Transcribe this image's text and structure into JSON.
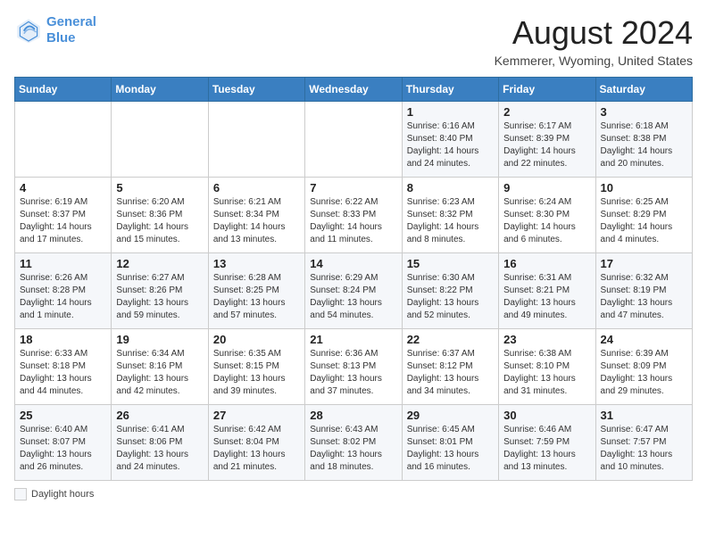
{
  "header": {
    "logo_line1": "General",
    "logo_line2": "Blue",
    "month": "August 2024",
    "location": "Kemmerer, Wyoming, United States"
  },
  "weekdays": [
    "Sunday",
    "Monday",
    "Tuesday",
    "Wednesday",
    "Thursday",
    "Friday",
    "Saturday"
  ],
  "weeks": [
    [
      {
        "day": "",
        "info": ""
      },
      {
        "day": "",
        "info": ""
      },
      {
        "day": "",
        "info": ""
      },
      {
        "day": "",
        "info": ""
      },
      {
        "day": "1",
        "info": "Sunrise: 6:16 AM\nSunset: 8:40 PM\nDaylight: 14 hours\nand 24 minutes."
      },
      {
        "day": "2",
        "info": "Sunrise: 6:17 AM\nSunset: 8:39 PM\nDaylight: 14 hours\nand 22 minutes."
      },
      {
        "day": "3",
        "info": "Sunrise: 6:18 AM\nSunset: 8:38 PM\nDaylight: 14 hours\nand 20 minutes."
      }
    ],
    [
      {
        "day": "4",
        "info": "Sunrise: 6:19 AM\nSunset: 8:37 PM\nDaylight: 14 hours\nand 17 minutes."
      },
      {
        "day": "5",
        "info": "Sunrise: 6:20 AM\nSunset: 8:36 PM\nDaylight: 14 hours\nand 15 minutes."
      },
      {
        "day": "6",
        "info": "Sunrise: 6:21 AM\nSunset: 8:34 PM\nDaylight: 14 hours\nand 13 minutes."
      },
      {
        "day": "7",
        "info": "Sunrise: 6:22 AM\nSunset: 8:33 PM\nDaylight: 14 hours\nand 11 minutes."
      },
      {
        "day": "8",
        "info": "Sunrise: 6:23 AM\nSunset: 8:32 PM\nDaylight: 14 hours\nand 8 minutes."
      },
      {
        "day": "9",
        "info": "Sunrise: 6:24 AM\nSunset: 8:30 PM\nDaylight: 14 hours\nand 6 minutes."
      },
      {
        "day": "10",
        "info": "Sunrise: 6:25 AM\nSunset: 8:29 PM\nDaylight: 14 hours\nand 4 minutes."
      }
    ],
    [
      {
        "day": "11",
        "info": "Sunrise: 6:26 AM\nSunset: 8:28 PM\nDaylight: 14 hours\nand 1 minute."
      },
      {
        "day": "12",
        "info": "Sunrise: 6:27 AM\nSunset: 8:26 PM\nDaylight: 13 hours\nand 59 minutes."
      },
      {
        "day": "13",
        "info": "Sunrise: 6:28 AM\nSunset: 8:25 PM\nDaylight: 13 hours\nand 57 minutes."
      },
      {
        "day": "14",
        "info": "Sunrise: 6:29 AM\nSunset: 8:24 PM\nDaylight: 13 hours\nand 54 minutes."
      },
      {
        "day": "15",
        "info": "Sunrise: 6:30 AM\nSunset: 8:22 PM\nDaylight: 13 hours\nand 52 minutes."
      },
      {
        "day": "16",
        "info": "Sunrise: 6:31 AM\nSunset: 8:21 PM\nDaylight: 13 hours\nand 49 minutes."
      },
      {
        "day": "17",
        "info": "Sunrise: 6:32 AM\nSunset: 8:19 PM\nDaylight: 13 hours\nand 47 minutes."
      }
    ],
    [
      {
        "day": "18",
        "info": "Sunrise: 6:33 AM\nSunset: 8:18 PM\nDaylight: 13 hours\nand 44 minutes."
      },
      {
        "day": "19",
        "info": "Sunrise: 6:34 AM\nSunset: 8:16 PM\nDaylight: 13 hours\nand 42 minutes."
      },
      {
        "day": "20",
        "info": "Sunrise: 6:35 AM\nSunset: 8:15 PM\nDaylight: 13 hours\nand 39 minutes."
      },
      {
        "day": "21",
        "info": "Sunrise: 6:36 AM\nSunset: 8:13 PM\nDaylight: 13 hours\nand 37 minutes."
      },
      {
        "day": "22",
        "info": "Sunrise: 6:37 AM\nSunset: 8:12 PM\nDaylight: 13 hours\nand 34 minutes."
      },
      {
        "day": "23",
        "info": "Sunrise: 6:38 AM\nSunset: 8:10 PM\nDaylight: 13 hours\nand 31 minutes."
      },
      {
        "day": "24",
        "info": "Sunrise: 6:39 AM\nSunset: 8:09 PM\nDaylight: 13 hours\nand 29 minutes."
      }
    ],
    [
      {
        "day": "25",
        "info": "Sunrise: 6:40 AM\nSunset: 8:07 PM\nDaylight: 13 hours\nand 26 minutes."
      },
      {
        "day": "26",
        "info": "Sunrise: 6:41 AM\nSunset: 8:06 PM\nDaylight: 13 hours\nand 24 minutes."
      },
      {
        "day": "27",
        "info": "Sunrise: 6:42 AM\nSunset: 8:04 PM\nDaylight: 13 hours\nand 21 minutes."
      },
      {
        "day": "28",
        "info": "Sunrise: 6:43 AM\nSunset: 8:02 PM\nDaylight: 13 hours\nand 18 minutes."
      },
      {
        "day": "29",
        "info": "Sunrise: 6:45 AM\nSunset: 8:01 PM\nDaylight: 13 hours\nand 16 minutes."
      },
      {
        "day": "30",
        "info": "Sunrise: 6:46 AM\nSunset: 7:59 PM\nDaylight: 13 hours\nand 13 minutes."
      },
      {
        "day": "31",
        "info": "Sunrise: 6:47 AM\nSunset: 7:57 PM\nDaylight: 13 hours\nand 10 minutes."
      }
    ]
  ],
  "footer": {
    "daylight_label": "Daylight hours"
  }
}
